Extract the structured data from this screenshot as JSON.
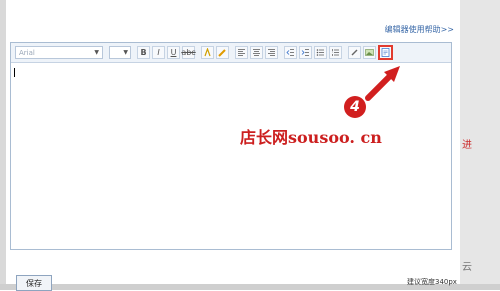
{
  "header": {
    "help_link": "编辑器使用帮助>>"
  },
  "toolbar": {
    "font_placeholder": "Arial",
    "buttons": [
      "B",
      "I",
      "U",
      "abc"
    ]
  },
  "annotation": {
    "step_number": "4"
  },
  "watermark": "店长网sousoo. cn",
  "footer": {
    "save_label": "保存",
    "width_tip": "建议宽度340px"
  },
  "edge": {
    "red_glyph": "进",
    "grey_glyph": "云"
  }
}
